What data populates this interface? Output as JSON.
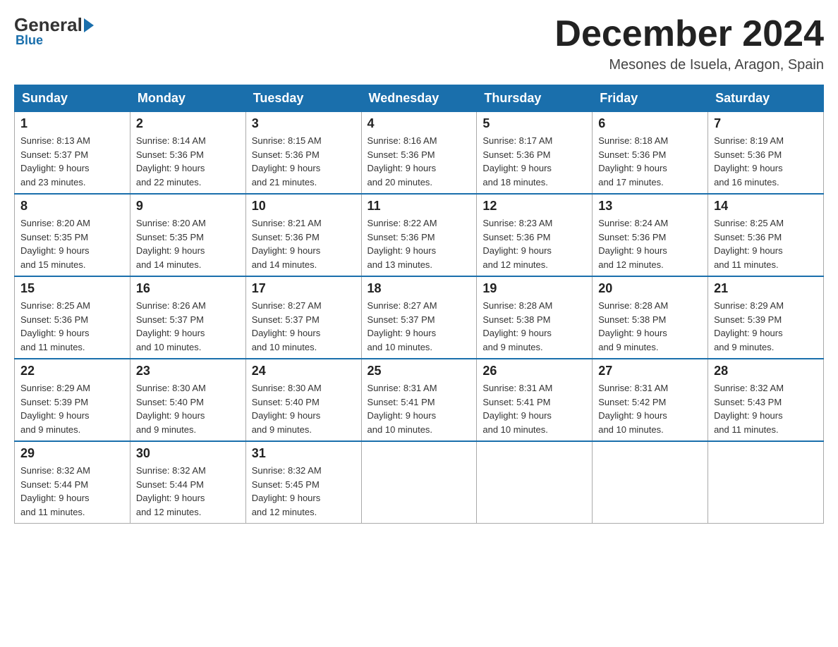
{
  "logo": {
    "general": "General",
    "blue": "Blue",
    "subtitle": "Blue"
  },
  "header": {
    "month_title": "December 2024",
    "location": "Mesones de Isuela, Aragon, Spain"
  },
  "weekdays": [
    "Sunday",
    "Monday",
    "Tuesday",
    "Wednesday",
    "Thursday",
    "Friday",
    "Saturday"
  ],
  "weeks": [
    [
      {
        "day": "1",
        "sunrise": "8:13 AM",
        "sunset": "5:37 PM",
        "daylight": "9 hours and 23 minutes."
      },
      {
        "day": "2",
        "sunrise": "8:14 AM",
        "sunset": "5:36 PM",
        "daylight": "9 hours and 22 minutes."
      },
      {
        "day": "3",
        "sunrise": "8:15 AM",
        "sunset": "5:36 PM",
        "daylight": "9 hours and 21 minutes."
      },
      {
        "day": "4",
        "sunrise": "8:16 AM",
        "sunset": "5:36 PM",
        "daylight": "9 hours and 20 minutes."
      },
      {
        "day": "5",
        "sunrise": "8:17 AM",
        "sunset": "5:36 PM",
        "daylight": "9 hours and 18 minutes."
      },
      {
        "day": "6",
        "sunrise": "8:18 AM",
        "sunset": "5:36 PM",
        "daylight": "9 hours and 17 minutes."
      },
      {
        "day": "7",
        "sunrise": "8:19 AM",
        "sunset": "5:36 PM",
        "daylight": "9 hours and 16 minutes."
      }
    ],
    [
      {
        "day": "8",
        "sunrise": "8:20 AM",
        "sunset": "5:35 PM",
        "daylight": "9 hours and 15 minutes."
      },
      {
        "day": "9",
        "sunrise": "8:20 AM",
        "sunset": "5:35 PM",
        "daylight": "9 hours and 14 minutes."
      },
      {
        "day": "10",
        "sunrise": "8:21 AM",
        "sunset": "5:36 PM",
        "daylight": "9 hours and 14 minutes."
      },
      {
        "day": "11",
        "sunrise": "8:22 AM",
        "sunset": "5:36 PM",
        "daylight": "9 hours and 13 minutes."
      },
      {
        "day": "12",
        "sunrise": "8:23 AM",
        "sunset": "5:36 PM",
        "daylight": "9 hours and 12 minutes."
      },
      {
        "day": "13",
        "sunrise": "8:24 AM",
        "sunset": "5:36 PM",
        "daylight": "9 hours and 12 minutes."
      },
      {
        "day": "14",
        "sunrise": "8:25 AM",
        "sunset": "5:36 PM",
        "daylight": "9 hours and 11 minutes."
      }
    ],
    [
      {
        "day": "15",
        "sunrise": "8:25 AM",
        "sunset": "5:36 PM",
        "daylight": "9 hours and 11 minutes."
      },
      {
        "day": "16",
        "sunrise": "8:26 AM",
        "sunset": "5:37 PM",
        "daylight": "9 hours and 10 minutes."
      },
      {
        "day": "17",
        "sunrise": "8:27 AM",
        "sunset": "5:37 PM",
        "daylight": "9 hours and 10 minutes."
      },
      {
        "day": "18",
        "sunrise": "8:27 AM",
        "sunset": "5:37 PM",
        "daylight": "9 hours and 10 minutes."
      },
      {
        "day": "19",
        "sunrise": "8:28 AM",
        "sunset": "5:38 PM",
        "daylight": "9 hours and 9 minutes."
      },
      {
        "day": "20",
        "sunrise": "8:28 AM",
        "sunset": "5:38 PM",
        "daylight": "9 hours and 9 minutes."
      },
      {
        "day": "21",
        "sunrise": "8:29 AM",
        "sunset": "5:39 PM",
        "daylight": "9 hours and 9 minutes."
      }
    ],
    [
      {
        "day": "22",
        "sunrise": "8:29 AM",
        "sunset": "5:39 PM",
        "daylight": "9 hours and 9 minutes."
      },
      {
        "day": "23",
        "sunrise": "8:30 AM",
        "sunset": "5:40 PM",
        "daylight": "9 hours and 9 minutes."
      },
      {
        "day": "24",
        "sunrise": "8:30 AM",
        "sunset": "5:40 PM",
        "daylight": "9 hours and 9 minutes."
      },
      {
        "day": "25",
        "sunrise": "8:31 AM",
        "sunset": "5:41 PM",
        "daylight": "9 hours and 10 minutes."
      },
      {
        "day": "26",
        "sunrise": "8:31 AM",
        "sunset": "5:41 PM",
        "daylight": "9 hours and 10 minutes."
      },
      {
        "day": "27",
        "sunrise": "8:31 AM",
        "sunset": "5:42 PM",
        "daylight": "9 hours and 10 minutes."
      },
      {
        "day": "28",
        "sunrise": "8:32 AM",
        "sunset": "5:43 PM",
        "daylight": "9 hours and 11 minutes."
      }
    ],
    [
      {
        "day": "29",
        "sunrise": "8:32 AM",
        "sunset": "5:44 PM",
        "daylight": "9 hours and 11 minutes."
      },
      {
        "day": "30",
        "sunrise": "8:32 AM",
        "sunset": "5:44 PM",
        "daylight": "9 hours and 12 minutes."
      },
      {
        "day": "31",
        "sunrise": "8:32 AM",
        "sunset": "5:45 PM",
        "daylight": "9 hours and 12 minutes."
      },
      null,
      null,
      null,
      null
    ]
  ],
  "labels": {
    "sunrise": "Sunrise:",
    "sunset": "Sunset:",
    "daylight": "Daylight:"
  }
}
